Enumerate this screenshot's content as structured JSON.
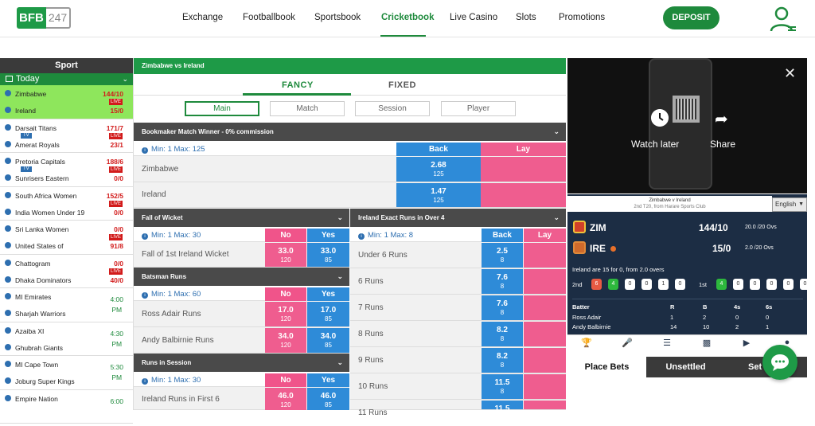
{
  "brand": {
    "logo_left": "BFB",
    "logo_right": "247",
    "accent": "#1e8a3c"
  },
  "nav": {
    "items": [
      "Exchange",
      "Footballbook",
      "Sportsbook",
      "Cricketbook",
      "Live Casino",
      "Slots",
      "Promotions"
    ],
    "active": "Cricketbook",
    "deposit": "DEPOSIT"
  },
  "sidebar": {
    "heading": "Sport",
    "today": "Today",
    "live_label": "LIVE",
    "tv_label": "TV",
    "matches": [
      {
        "team1": "Zimbabwe",
        "team2": "Ireland",
        "score1": "144/10",
        "score2": "15/0",
        "live": true,
        "tv": false,
        "selected": true
      },
      {
        "team1": "Darsait Titans",
        "team2": "Amerat Royals",
        "score1": "171/7",
        "score2": "23/1",
        "live": true,
        "tv": true
      },
      {
        "team1": "Pretoria Capitals",
        "team2": "Sunrisers Eastern",
        "score1": "188/6",
        "score2": "0/0",
        "live": true,
        "tv": true
      },
      {
        "team1": "South Africa Women",
        "team2": "India Women Under 19",
        "score1": "152/5",
        "score2": "0/0",
        "live": true,
        "tv": false
      },
      {
        "team1": "Sri Lanka Women",
        "team2": "United States of",
        "score1": "0/0",
        "score2": "91/8",
        "live": true,
        "tv": false
      },
      {
        "team1": "Chattogram",
        "team2": "Dhaka Dominators",
        "score1": "0/0",
        "score2": "40/0",
        "live": true,
        "tv": false
      },
      {
        "team1": "MI Emirates",
        "team2": "Sharjah Warriors",
        "time": "4:00",
        "ampm": "PM"
      },
      {
        "team1": "Azaiba XI",
        "team2": "Ghubrah Giants",
        "time": "4:30",
        "ampm": "PM"
      },
      {
        "team1": "MI Cape Town",
        "team2": "Joburg Super Kings",
        "time": "5:30",
        "ampm": "PM"
      },
      {
        "team1": "Empire Nation",
        "team2": "",
        "time": "6:00",
        "ampm": ""
      }
    ]
  },
  "event": {
    "title": "Zimbabwe vs Ireland",
    "tabs": [
      "FANCY",
      "FIXED"
    ],
    "subtabs": [
      "Main",
      "Match",
      "Session",
      "Player"
    ]
  },
  "bookmaker": {
    "title": "Bookmaker Match Winner - 0% commission",
    "minmax": "Min: 1 Max: 125",
    "back": "Back",
    "lay": "Lay",
    "rows": [
      {
        "name": "Zimbabwe",
        "back": "2.68",
        "back_size": "125"
      },
      {
        "name": "Ireland",
        "back": "1.47",
        "back_size": "125"
      }
    ]
  },
  "fall_of_wicket": {
    "title": "Fall of Wicket",
    "minmax": "Min: 1 Max: 30",
    "no": "No",
    "yes": "Yes",
    "rows": [
      {
        "name": "Fall of 1st Ireland Wicket",
        "no": "33.0",
        "no_size": "120",
        "yes": "33.0",
        "yes_size": "85"
      }
    ]
  },
  "batsman_runs": {
    "title": "Batsman Runs",
    "minmax": "Min: 1 Max: 60",
    "no": "No",
    "yes": "Yes",
    "rows": [
      {
        "name": "Ross Adair Runs",
        "no": "17.0",
        "no_size": "120",
        "yes": "17.0",
        "yes_size": "85"
      },
      {
        "name": "Andy Balbirnie Runs",
        "no": "34.0",
        "no_size": "120",
        "yes": "34.0",
        "yes_size": "85"
      }
    ]
  },
  "runs_in_session": {
    "title": "Runs in Session",
    "minmax": "Min: 1 Max: 30",
    "no": "No",
    "yes": "Yes",
    "rows": [
      {
        "name": "Ireland Runs in First 6",
        "no": "46.0",
        "no_size": "120",
        "yes": "46.0",
        "yes_size": "85"
      }
    ]
  },
  "exact_runs": {
    "title": "Ireland Exact Runs in Over 4",
    "minmax": "Min: 1 Max: 8",
    "back": "Back",
    "lay": "Lay",
    "rows": [
      {
        "name": "Under 6 Runs",
        "back": "2.5",
        "size": "8"
      },
      {
        "name": "6 Runs",
        "back": "7.6",
        "size": "8"
      },
      {
        "name": "7 Runs",
        "back": "7.6",
        "size": "8"
      },
      {
        "name": "8 Runs",
        "back": "8.2",
        "size": "8"
      },
      {
        "name": "9 Runs",
        "back": "8.2",
        "size": "8"
      },
      {
        "name": "10 Runs",
        "back": "11.5",
        "size": "8"
      },
      {
        "name": "11 Runs",
        "back": "11.5",
        "size": "8"
      }
    ]
  },
  "video": {
    "watch_later": "Watch later",
    "share": "Share"
  },
  "scoreboard": {
    "header_line1": "Zimbabwe v Ireland",
    "header_line2": "2nd T20, from Harare Sports Club",
    "language": "English",
    "team1": {
      "code": "ZIM",
      "score": "144/10",
      "overs": "20.0 /20 Ovs"
    },
    "team2": {
      "code": "IRE",
      "score": "15/0",
      "overs": "2.0 /20 Ovs"
    },
    "status": "Ireland are 15 for 0, from 2.0 overs",
    "over2_label": "2nd",
    "over2_balls": [
      "6",
      "4",
      "0",
      "0",
      "1",
      "0"
    ],
    "over1_label": "1st",
    "over1_balls": [
      "4",
      "0",
      "0",
      "0",
      "0",
      "0"
    ],
    "batter_headers": [
      "Batter",
      "R",
      "B",
      "4s",
      "6s"
    ],
    "batters": [
      {
        "name": "Ross Adair",
        "r": "1",
        "b": "2",
        "fours": "0",
        "sixes": "0"
      },
      {
        "name": "Andy Balbirnie",
        "r": "14",
        "b": "10",
        "fours": "2",
        "sixes": "1"
      }
    ]
  },
  "bets": {
    "tabs": [
      "Place Bets",
      "Unsettled",
      "Set"
    ]
  }
}
